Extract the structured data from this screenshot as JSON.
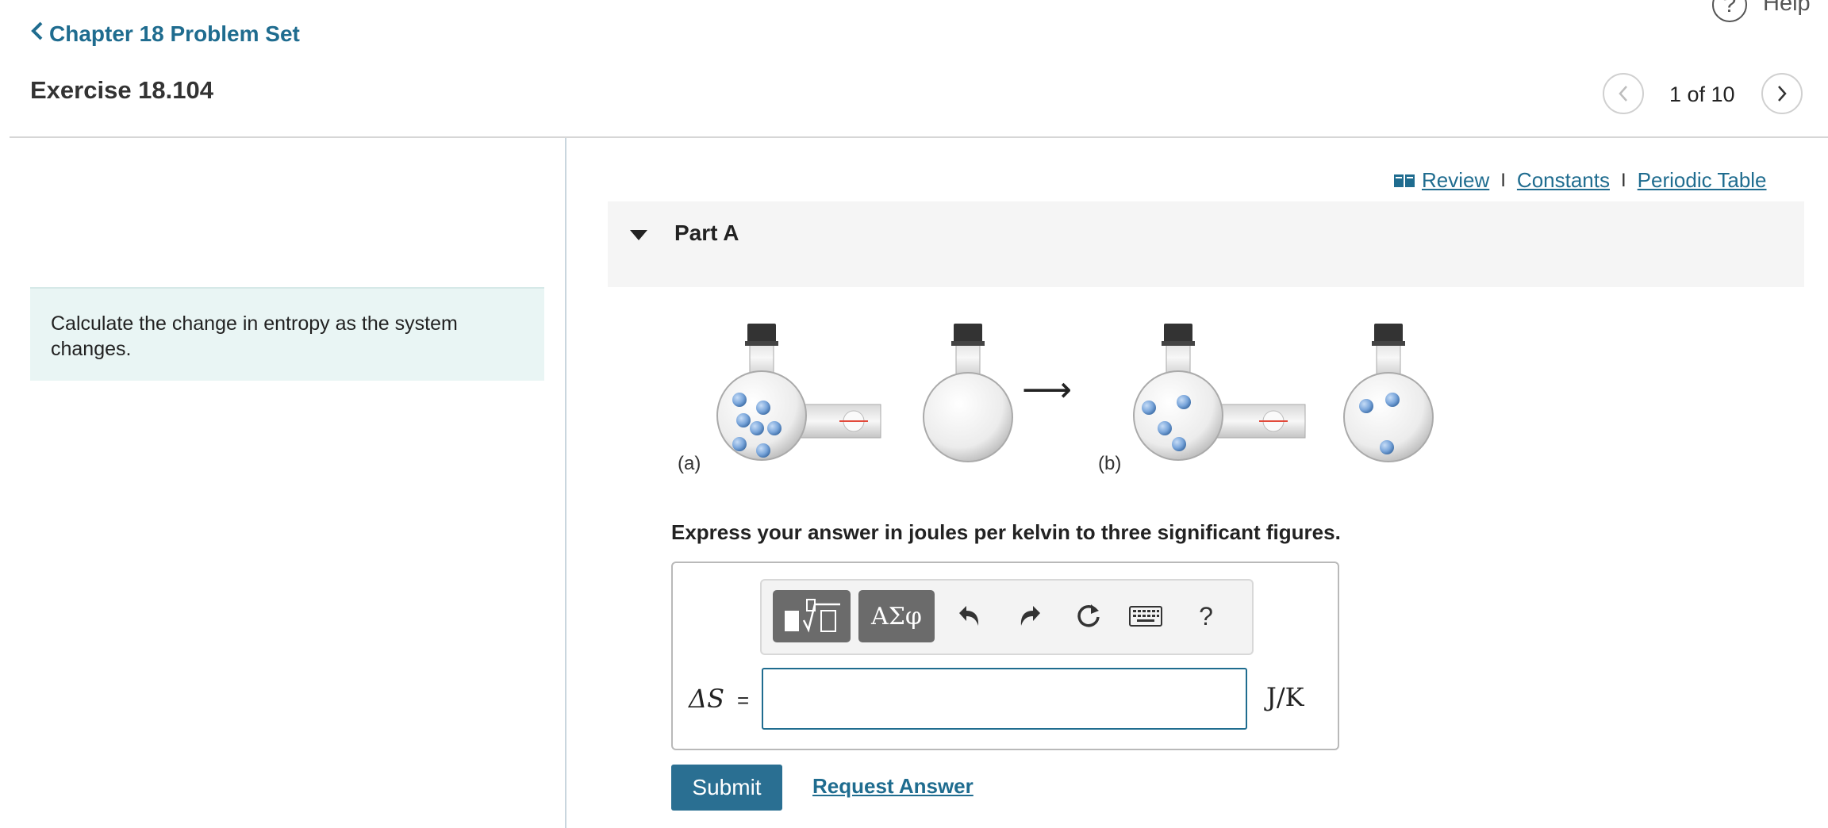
{
  "header": {
    "help_label": "Help",
    "back_label": "Chapter 18 Problem Set",
    "exercise_title": "Exercise 18.104",
    "pager": "1 of 10"
  },
  "intro": {
    "text": "Calculate the change in entropy as the system changes."
  },
  "resources": {
    "review": "Review",
    "separator": "I",
    "constants": "Constants",
    "periodic_table": "Periodic Table"
  },
  "part": {
    "title": "Part A"
  },
  "figure": {
    "label_a": "(a)",
    "label_b": "(b)",
    "arrow": "⟶"
  },
  "question": {
    "instruction": "Express your answer in joules per kelvin to three significant figures."
  },
  "answer": {
    "lhs": "ΔS",
    "equals": "=",
    "value": "",
    "unit": "J/K",
    "greek_label": "ΑΣφ",
    "help_symbol": "?"
  },
  "actions": {
    "submit": "Submit",
    "request_answer": "Request Answer"
  },
  "colors": {
    "link": "#1f6c8f",
    "button": "#2a6f92",
    "intro_bg": "#e9f5f4",
    "molecule": "#7aa6db"
  }
}
